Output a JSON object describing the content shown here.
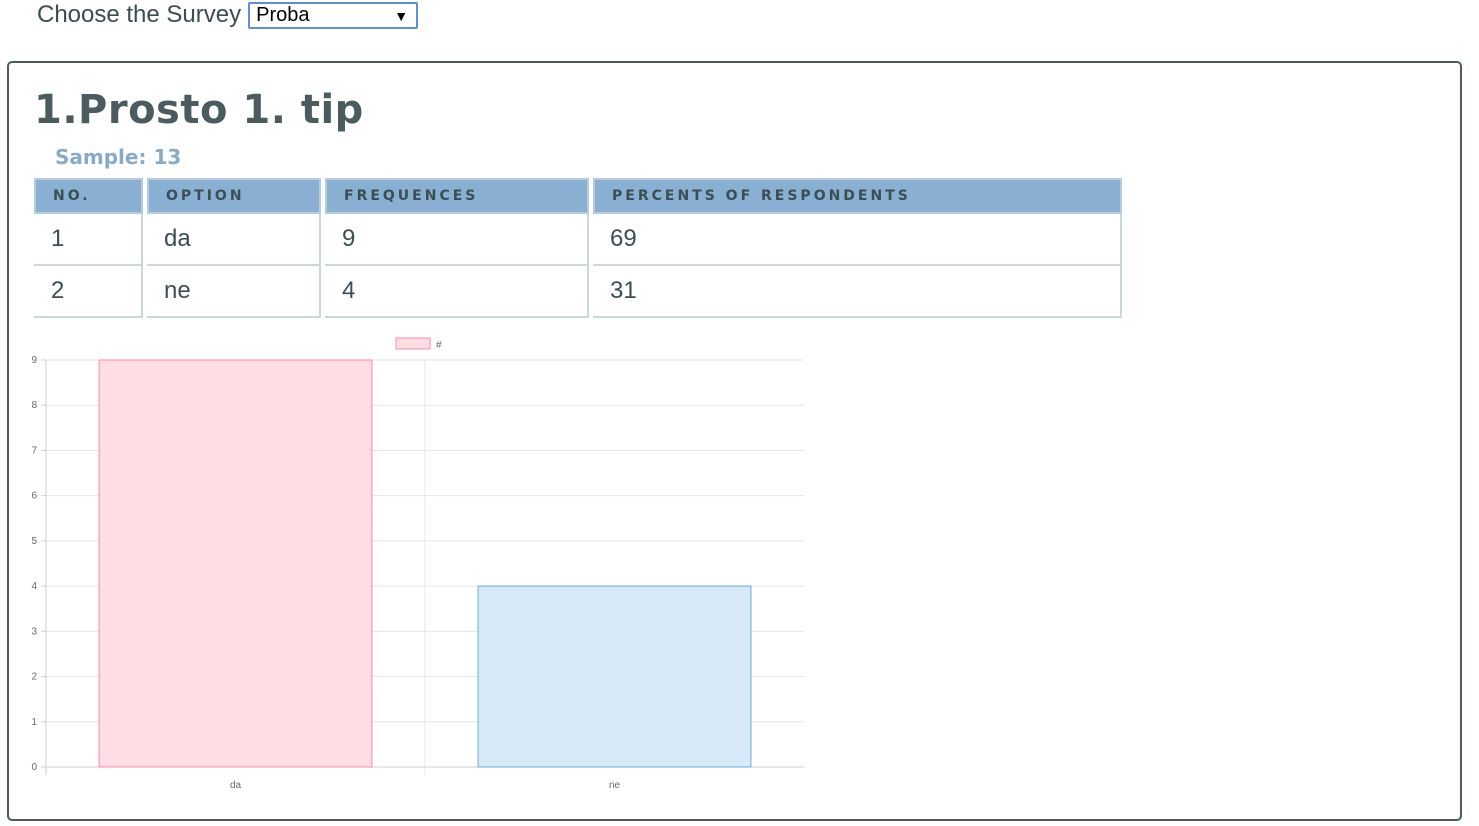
{
  "survey_selector": {
    "label": "Choose the Survey",
    "selected": "Proba",
    "arrow": "▼"
  },
  "question": {
    "title": "1.Prosto 1. tip",
    "sample": "Sample: 13"
  },
  "table": {
    "headers": [
      "NO.",
      "OPTION",
      "FREQUENCES",
      "PERCENTS OF RESPONDENTS"
    ],
    "rows": [
      [
        "1",
        "da",
        "9",
        "69"
      ],
      [
        "2",
        "ne",
        "4",
        "31"
      ]
    ]
  },
  "chart_data": {
    "type": "bar",
    "categories": [
      "da",
      "ne"
    ],
    "series": [
      {
        "name": "#",
        "values": [
          9,
          4
        ]
      }
    ],
    "bar_fill_colors": [
      "#ffdde4",
      "#d6eaf8"
    ],
    "bar_stroke_colors": [
      "#ff8aa5",
      "#6aaedc"
    ],
    "ylim": [
      0,
      9
    ],
    "yticks": [
      0,
      1,
      2,
      3,
      4,
      5,
      6,
      7,
      8,
      9
    ],
    "grid": true,
    "legend": "top-center"
  }
}
